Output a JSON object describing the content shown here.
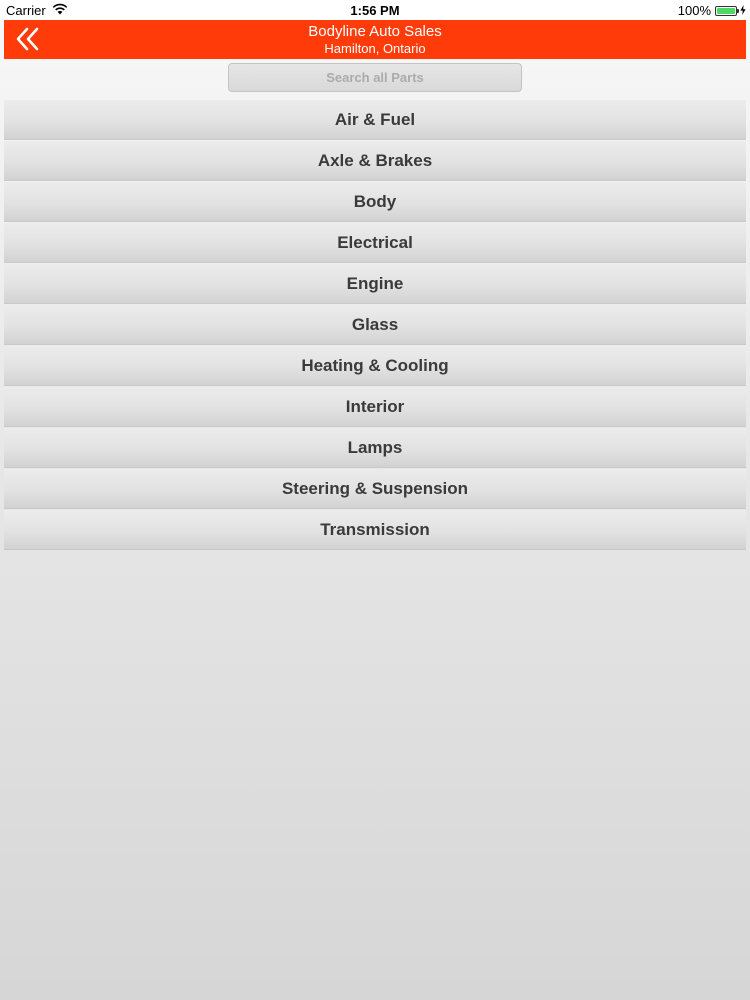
{
  "status_bar": {
    "carrier": "Carrier",
    "time": "1:56 PM",
    "battery_percent": "100%",
    "battery_level": 1.0
  },
  "nav": {
    "title": "Bodyline Auto Sales",
    "subtitle": "Hamilton, Ontario",
    "back_icon": "double-chevron-left-icon",
    "accent_color": "#ff3b0a"
  },
  "search": {
    "placeholder": "Search all Parts",
    "value": ""
  },
  "categories": [
    "Air & Fuel",
    "Axle & Brakes",
    "Body",
    "Electrical",
    "Engine",
    "Glass",
    "Heating & Cooling",
    "Interior",
    "Lamps",
    "Steering & Suspension",
    "Transmission"
  ]
}
